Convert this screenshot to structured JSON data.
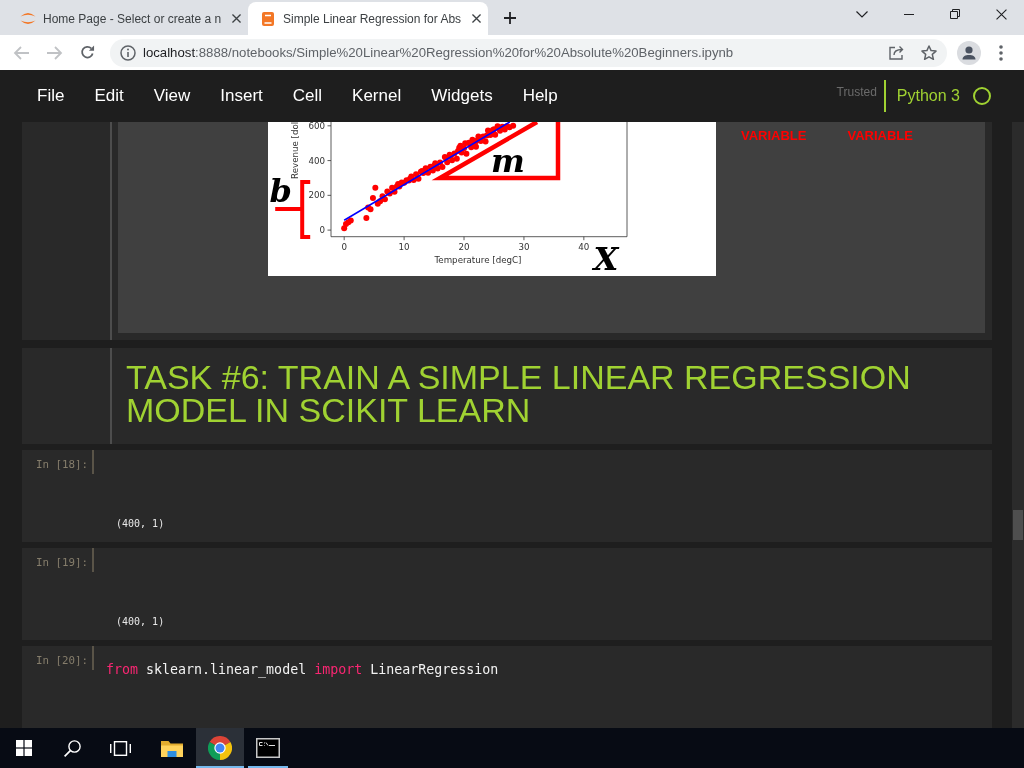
{
  "browser": {
    "tabs": [
      {
        "kind": "home",
        "title": "Home Page - Select or create a n",
        "selected": false
      },
      {
        "kind": "notebook",
        "title": "Simple Linear Regression for Abs",
        "selected": true
      }
    ],
    "navigation": {
      "back": {
        "disabled": true
      },
      "forward": {
        "disabled": true
      }
    },
    "address_bar": {
      "host": "localhost",
      "path": ":8888/notebooks/Simple%20Linear%20Regression%20for%20Absolute%20Beginners.ipynb"
    }
  },
  "menu_bar": {
    "items": [
      "File",
      "Edit",
      "View",
      "Insert",
      "Cell",
      "Kernel",
      "Widgets",
      "Help"
    ],
    "trusted": "Trusted",
    "kernel": "Python 3",
    "kernel_busy": false
  },
  "cells": [
    {
      "kind": "image_markdown",
      "chart_data": {
        "type": "scatter",
        "xlabel": "Temperature [degC]",
        "ylabel": "Revenue [dol",
        "x": [
          0,
          0.3,
          0.7,
          1.1,
          3.7,
          4,
          4.4,
          4.8,
          5.2,
          5.6,
          6,
          6.4,
          6.8,
          7.2,
          7.6,
          8,
          8.4,
          8.8,
          9,
          9.2,
          9.6,
          10,
          10.4,
          10.8,
          11,
          11.2,
          11.6,
          12,
          12.4,
          12.8,
          13,
          13.2,
          13.6,
          14,
          14.4,
          14.8,
          15,
          15.2,
          15.4,
          15.6,
          16,
          16.4,
          16.8,
          17,
          17.2,
          17.6,
          17.8,
          18,
          18.4,
          18.8,
          19,
          19.2,
          19.4,
          19.6,
          20,
          20.2,
          20.4,
          20.8,
          21,
          21.2,
          21.4,
          21.8,
          22,
          22.2,
          22.4,
          22.8,
          23.2,
          23.6,
          23.8,
          24,
          24.4,
          24.8,
          25,
          25.2,
          25.6,
          26,
          26.4,
          26.8,
          27.2,
          27.6,
          28.2
        ],
        "series": [
          {
            "color": "#ff0000",
            "values": [
              10,
              35,
              45,
              55,
              70,
              130,
              120,
              185,
              243,
              152,
              166,
              195,
              178,
              222,
              211,
              244,
              220,
              252,
              265,
              251,
              274,
              273,
              287,
              285,
              295,
              309,
              288,
              322,
              295,
              336,
              340,
              328,
              356,
              330,
              364,
              343,
              370,
              384,
              372,
              355,
              389,
              363,
              421,
              415,
              390,
              434,
              425,
              402,
              441,
              410,
              455,
              474,
              485,
              447,
              471,
              500,
              440,
              503,
              495,
              477,
              520,
              500,
              480,
              515,
              538,
              512,
              539,
              510,
              545,
              573,
              547,
              576,
              580,
              549,
              598,
              572,
              595,
              579,
              598,
              592,
              600
            ]
          }
        ],
        "xlim": [
          -2.2,
          47.2
        ],
        "ylim": [
          -38,
          622
        ],
        "xticks": [
          0,
          10,
          20,
          30,
          40
        ],
        "yticks": [
          0,
          200,
          400,
          600
        ],
        "annotations": [
          "b",
          "m",
          "X"
        ]
      },
      "labels": [
        "VARIABLE",
        "VARIABLE"
      ]
    },
    {
      "kind": "heading",
      "text": "TASK #6: TRAIN A SIMPLE LINEAR REGRESSION MODEL IN SCIKIT LEARN"
    },
    {
      "kind": "code",
      "prompt": "In [18]:",
      "output": "(400, 1)"
    },
    {
      "kind": "code",
      "prompt": "In [19]:",
      "output": "(400, 1)"
    },
    {
      "kind": "code",
      "prompt": "In [20]:",
      "code": [
        {
          "kind": "keyword",
          "text": "from"
        },
        {
          "kind": "name",
          "text": " sklearn.linear_model "
        },
        {
          "kind": "keyword",
          "text": "import"
        },
        {
          "kind": "name",
          "text": " LinearRegression"
        }
      ]
    }
  ],
  "taskbar": {
    "apps": [
      {
        "kind": "folder",
        "running": false,
        "selected": false
      },
      {
        "kind": "browser",
        "running": true,
        "selected": true
      },
      {
        "kind": "terminal",
        "running": true,
        "selected": false
      }
    ]
  }
}
